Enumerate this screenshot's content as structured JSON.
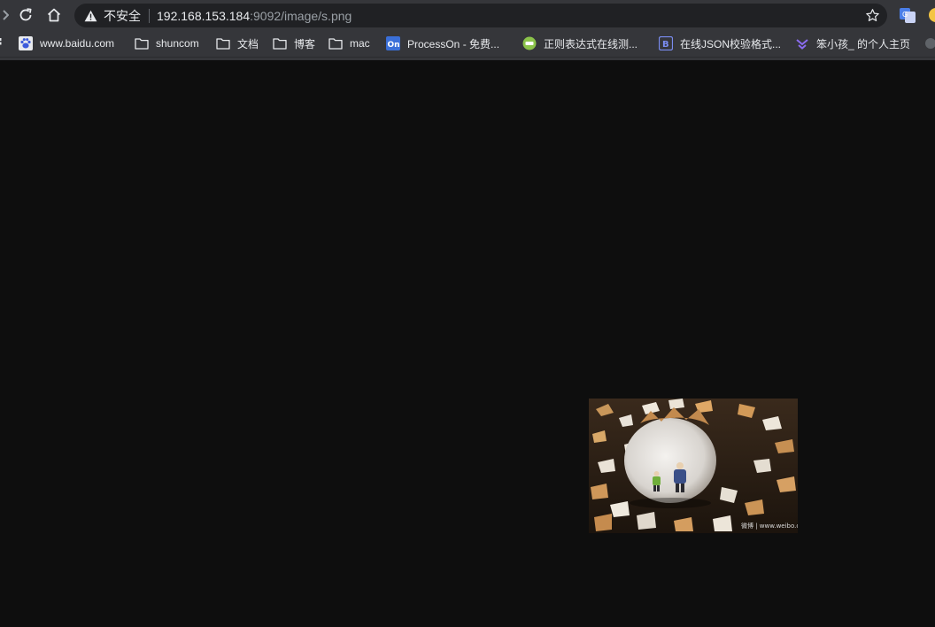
{
  "address_bar": {
    "security_label": "不安全",
    "host": "192.168.153.184",
    "path": ":9092/image/s.png"
  },
  "bookmarks": [
    {
      "label": "www.baidu.com",
      "icon": "baidu-paw-icon"
    },
    {
      "label": "shuncom",
      "icon": "folder-icon"
    },
    {
      "label": "文档",
      "icon": "folder-icon"
    },
    {
      "label": "博客",
      "icon": "folder-icon"
    },
    {
      "label": "mac",
      "icon": "folder-icon"
    },
    {
      "label": "ProcessOn - 免费...",
      "icon": "processon-icon"
    },
    {
      "label": "正则表达式在线测...",
      "icon": "regex-tool-icon"
    },
    {
      "label": "在线JSON校验格式...",
      "icon": "json-tool-icon"
    },
    {
      "label": "笨小孩_ 的个人主页",
      "icon": "profile-icon"
    }
  ],
  "image_watermark": "微博 | www.weibo.com/...",
  "colors": {
    "chrome_bg": "#35363a",
    "omnibox_bg": "#202124",
    "page_bg": "#0e0e0e",
    "text": "#e8eaed",
    "muted_text": "#9aa0a6"
  }
}
